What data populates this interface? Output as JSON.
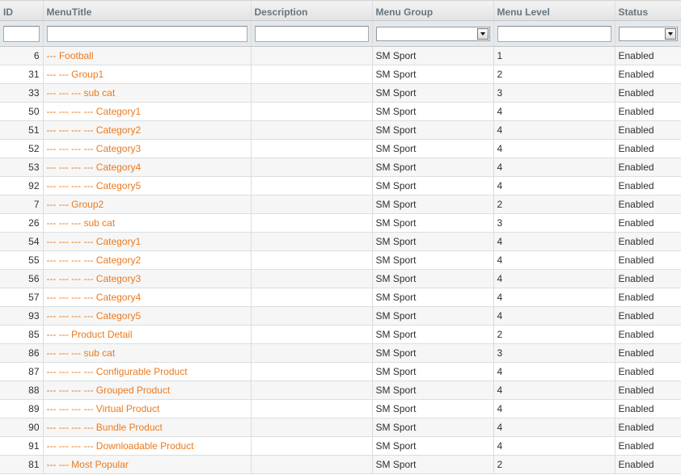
{
  "columns": {
    "id": "ID",
    "menu_title": "MenuTitle",
    "description": "Description",
    "menu_group": "Menu Group",
    "menu_level": "Menu Level",
    "status": "Status"
  },
  "filters": {
    "id": "",
    "menu_title": "",
    "description": "",
    "menu_group": "",
    "menu_level": "",
    "status": ""
  },
  "rows": [
    {
      "id": "6",
      "title": "--- Football",
      "description": "",
      "group": "SM Sport",
      "level": "1",
      "status": "Enabled"
    },
    {
      "id": "31",
      "title": "--- --- Group1",
      "description": "",
      "group": "SM Sport",
      "level": "2",
      "status": "Enabled"
    },
    {
      "id": "33",
      "title": "--- --- --- sub cat",
      "description": "",
      "group": "SM Sport",
      "level": "3",
      "status": "Enabled"
    },
    {
      "id": "50",
      "title": "--- --- --- --- Category1",
      "description": "",
      "group": "SM Sport",
      "level": "4",
      "status": "Enabled"
    },
    {
      "id": "51",
      "title": "--- --- --- --- Category2",
      "description": "",
      "group": "SM Sport",
      "level": "4",
      "status": "Enabled"
    },
    {
      "id": "52",
      "title": "--- --- --- --- Category3",
      "description": "",
      "group": "SM Sport",
      "level": "4",
      "status": "Enabled"
    },
    {
      "id": "53",
      "title": "--- --- --- --- Category4",
      "description": "",
      "group": "SM Sport",
      "level": "4",
      "status": "Enabled"
    },
    {
      "id": "92",
      "title": "--- --- --- --- Category5",
      "description": "",
      "group": "SM Sport",
      "level": "4",
      "status": "Enabled"
    },
    {
      "id": "7",
      "title": "--- --- Group2",
      "description": "",
      "group": "SM Sport",
      "level": "2",
      "status": "Enabled"
    },
    {
      "id": "26",
      "title": "--- --- --- sub cat",
      "description": "",
      "group": "SM Sport",
      "level": "3",
      "status": "Enabled"
    },
    {
      "id": "54",
      "title": "--- --- --- --- Category1",
      "description": "",
      "group": "SM Sport",
      "level": "4",
      "status": "Enabled"
    },
    {
      "id": "55",
      "title": "--- --- --- --- Category2",
      "description": "",
      "group": "SM Sport",
      "level": "4",
      "status": "Enabled"
    },
    {
      "id": "56",
      "title": "--- --- --- --- Category3",
      "description": "",
      "group": "SM Sport",
      "level": "4",
      "status": "Enabled"
    },
    {
      "id": "57",
      "title": "--- --- --- --- Category4",
      "description": "",
      "group": "SM Sport",
      "level": "4",
      "status": "Enabled"
    },
    {
      "id": "93",
      "title": "--- --- --- --- Category5",
      "description": "",
      "group": "SM Sport",
      "level": "4",
      "status": "Enabled"
    },
    {
      "id": "85",
      "title": "--- --- Product Detail",
      "description": "",
      "group": "SM Sport",
      "level": "2",
      "status": "Enabled"
    },
    {
      "id": "86",
      "title": "--- --- --- sub cat",
      "description": "",
      "group": "SM Sport",
      "level": "3",
      "status": "Enabled"
    },
    {
      "id": "87",
      "title": "--- --- --- --- Configurable Product",
      "description": "",
      "group": "SM Sport",
      "level": "4",
      "status": "Enabled"
    },
    {
      "id": "88",
      "title": "--- --- --- --- Grouped Product",
      "description": "",
      "group": "SM Sport",
      "level": "4",
      "status": "Enabled"
    },
    {
      "id": "89",
      "title": "--- --- --- --- Virtual Product",
      "description": "",
      "group": "SM Sport",
      "level": "4",
      "status": "Enabled"
    },
    {
      "id": "90",
      "title": "--- --- --- --- Bundle Product",
      "description": "",
      "group": "SM Sport",
      "level": "4",
      "status": "Enabled"
    },
    {
      "id": "91",
      "title": "--- --- --- --- Downloadable Product",
      "description": "",
      "group": "SM Sport",
      "level": "4",
      "status": "Enabled"
    },
    {
      "id": "81",
      "title": "--- --- Most Popular",
      "description": "",
      "group": "SM Sport",
      "level": "2",
      "status": "Enabled"
    }
  ]
}
